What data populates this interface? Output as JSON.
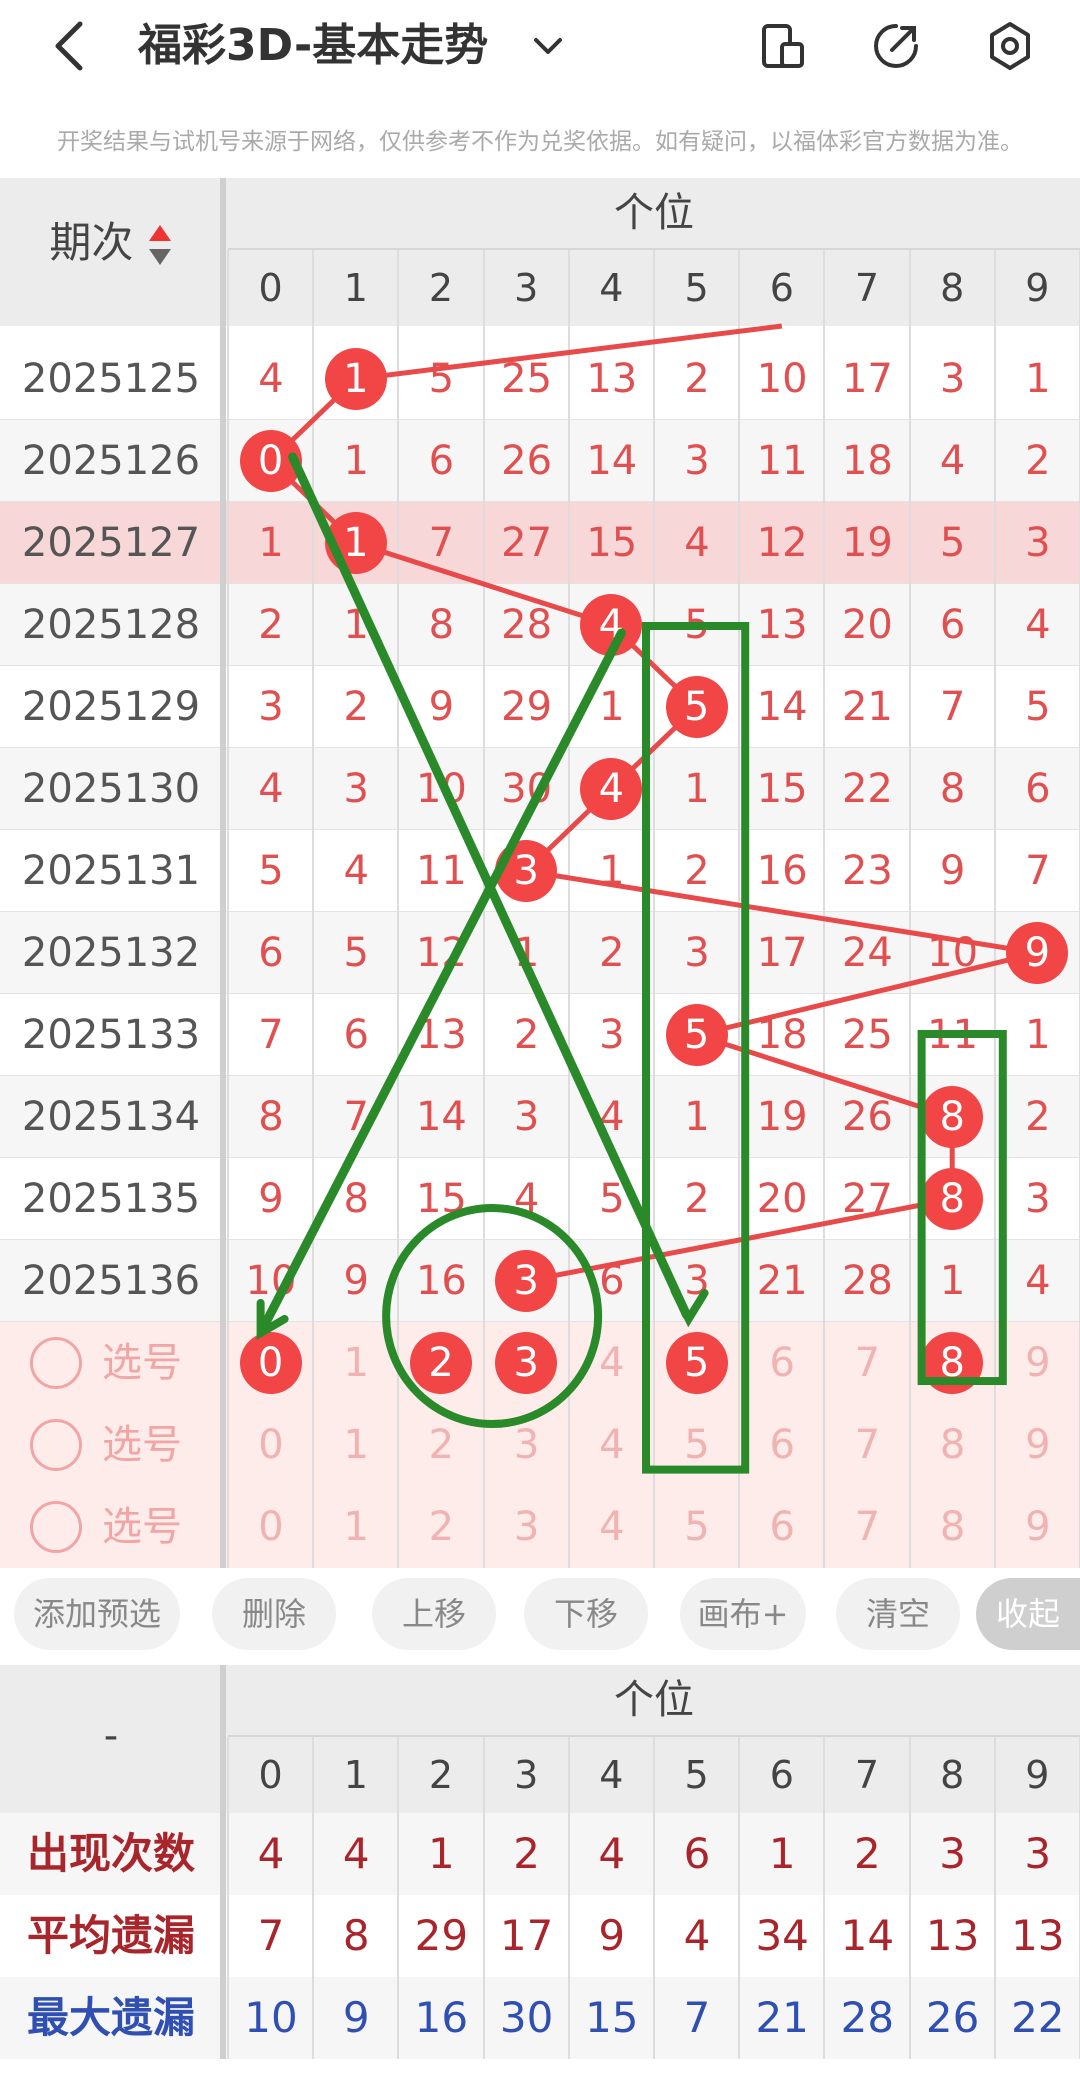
{
  "header": {
    "title": "福彩3D-基本走势",
    "icons": [
      "back-arrow-icon",
      "chevron-down-icon",
      "device-icon",
      "share-icon",
      "settings-icon"
    ]
  },
  "notice": "开奖结果与试机号来源于网络，仅供参考不作为兑奖依据。如有疑问，以福体彩官方数据为准。",
  "table": {
    "period_header": "期次",
    "group_header": "个位",
    "digits": [
      "0",
      "1",
      "2",
      "3",
      "4",
      "5",
      "6",
      "7",
      "8",
      "9"
    ],
    "rows": [
      {
        "period": "2025125",
        "cells": [
          "4",
          "1",
          "5",
          "25",
          "13",
          "2",
          "10",
          "17",
          "3",
          "1"
        ],
        "hit": 1
      },
      {
        "period": "2025126",
        "cells": [
          "0",
          "1",
          "6",
          "26",
          "14",
          "3",
          "11",
          "18",
          "4",
          "2"
        ],
        "hit": 0
      },
      {
        "period": "2025127",
        "cells": [
          "1",
          "1",
          "7",
          "27",
          "15",
          "4",
          "12",
          "19",
          "5",
          "3"
        ],
        "hit": 1
      },
      {
        "period": "2025128",
        "cells": [
          "2",
          "1",
          "8",
          "28",
          "4",
          "5",
          "13",
          "20",
          "6",
          "4"
        ],
        "hit": 4
      },
      {
        "period": "2025129",
        "cells": [
          "3",
          "2",
          "9",
          "29",
          "1",
          "5",
          "14",
          "21",
          "7",
          "5"
        ],
        "hit": 5
      },
      {
        "period": "2025130",
        "cells": [
          "4",
          "3",
          "10",
          "30",
          "4",
          "1",
          "15",
          "22",
          "8",
          "6"
        ],
        "hit": 4
      },
      {
        "period": "2025131",
        "cells": [
          "5",
          "4",
          "11",
          "3",
          "1",
          "2",
          "16",
          "23",
          "9",
          "7"
        ],
        "hit": 3
      },
      {
        "period": "2025132",
        "cells": [
          "6",
          "5",
          "12",
          "1",
          "2",
          "3",
          "17",
          "24",
          "10",
          "9"
        ],
        "hit": 9
      },
      {
        "period": "2025133",
        "cells": [
          "7",
          "6",
          "13",
          "2",
          "3",
          "5",
          "18",
          "25",
          "11",
          "1"
        ],
        "hit": 5
      },
      {
        "period": "2025134",
        "cells": [
          "8",
          "7",
          "14",
          "3",
          "4",
          "1",
          "19",
          "26",
          "8",
          "2"
        ],
        "hit": 8
      },
      {
        "period": "2025135",
        "cells": [
          "9",
          "8",
          "15",
          "4",
          "5",
          "2",
          "20",
          "27",
          "8",
          "3"
        ],
        "hit": 8
      },
      {
        "period": "2025136",
        "cells": [
          "10",
          "9",
          "16",
          "3",
          "6",
          "3",
          "21",
          "28",
          "1",
          "4"
        ],
        "hit": 3
      }
    ],
    "highlight_period": "2025127",
    "pick_label": "选号",
    "pick_rows": [
      {
        "cells": [
          "0",
          "1",
          "2",
          "3",
          "4",
          "5",
          "6",
          "7",
          "8",
          "9"
        ],
        "selected": [
          0,
          2,
          3,
          5,
          8
        ]
      },
      {
        "cells": [
          "0",
          "1",
          "2",
          "3",
          "4",
          "5",
          "6",
          "7",
          "8",
          "9"
        ],
        "selected": []
      },
      {
        "cells": [
          "0",
          "1",
          "2",
          "3",
          "4",
          "5",
          "6",
          "7",
          "8",
          "9"
        ],
        "selected": []
      }
    ]
  },
  "toolbar": [
    "添加预选",
    "删除",
    "上移",
    "下移",
    "画布+",
    "清空",
    "收起"
  ],
  "stats": {
    "corner": "-",
    "group_header": "个位",
    "digits": [
      "0",
      "1",
      "2",
      "3",
      "4",
      "5",
      "6",
      "7",
      "8",
      "9"
    ],
    "rows": [
      {
        "label": "出现次数",
        "values": [
          "4",
          "4",
          "1",
          "2",
          "4",
          "6",
          "1",
          "2",
          "3",
          "3"
        ],
        "color": "#a8262b"
      },
      {
        "label": "平均遗漏",
        "values": [
          "7",
          "8",
          "29",
          "17",
          "9",
          "4",
          "34",
          "14",
          "13",
          "13"
        ],
        "color": "#a8262b"
      },
      {
        "label": "最大遗漏",
        "values": [
          "10",
          "9",
          "16",
          "30",
          "15",
          "7",
          "21",
          "28",
          "26",
          "22"
        ],
        "color": "#2f4fb2"
      }
    ]
  },
  "colors": {
    "ball": "#f24646",
    "trend_line": "#e84a4a",
    "annotation": "#2a8a2a",
    "highlight_row": "#f7d7d7",
    "pick_bg": "#fdecea"
  }
}
